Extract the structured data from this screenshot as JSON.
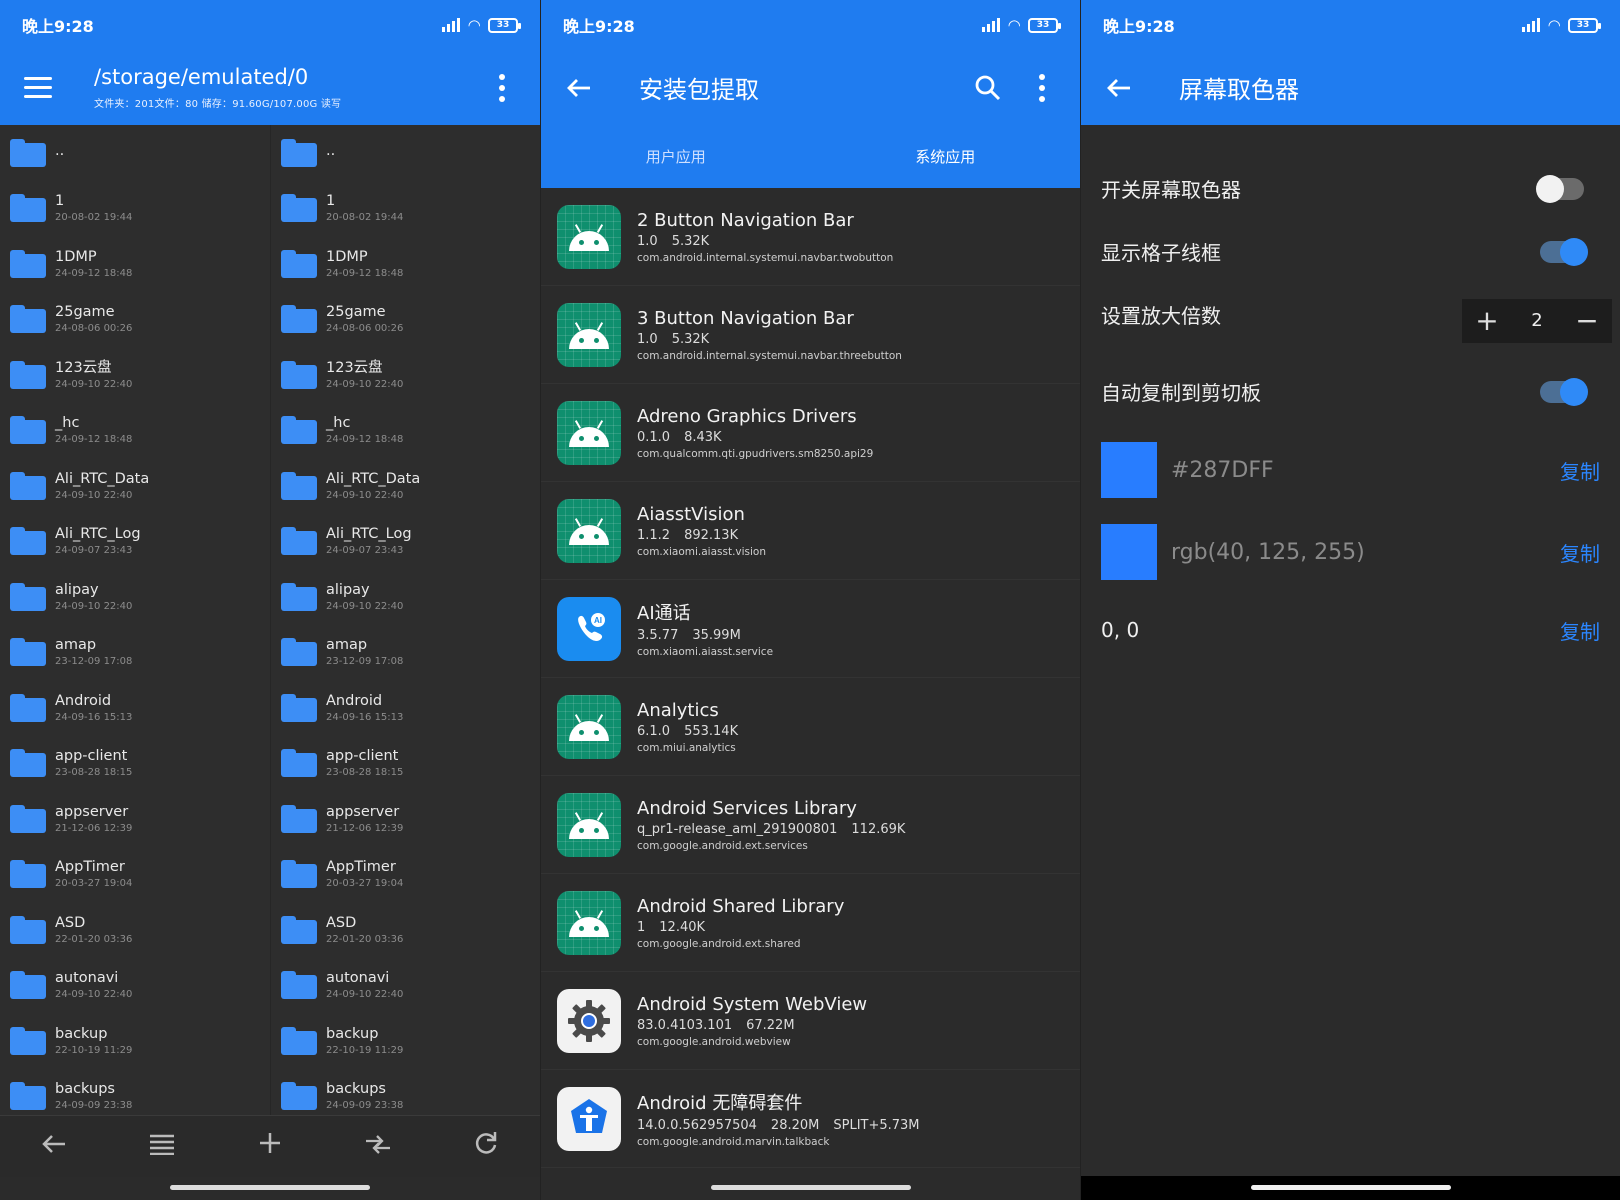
{
  "status": {
    "time": "晚上9:28",
    "battery": "33"
  },
  "screen1": {
    "path": "/storage/emulated/0",
    "subtitle": "文件夹：201文件：80   储存：91.60G/107.00G        读写",
    "folders": [
      {
        "name": "..",
        "date": ""
      },
      {
        "name": "1",
        "date": "20-08-02 19:44"
      },
      {
        "name": "1DMP",
        "date": "24-09-12 18:48"
      },
      {
        "name": "25game",
        "date": "24-08-06 00:26"
      },
      {
        "name": "123云盘",
        "date": "24-09-10 22:40"
      },
      {
        "name": "_hc",
        "date": "24-09-12 18:48"
      },
      {
        "name": "Ali_RTC_Data",
        "date": "24-09-10 22:40"
      },
      {
        "name": "Ali_RTC_Log",
        "date": "24-09-07 23:43"
      },
      {
        "name": "alipay",
        "date": "24-09-10 22:40"
      },
      {
        "name": "amap",
        "date": "23-12-09 17:08"
      },
      {
        "name": "Android",
        "date": "24-09-16 15:13"
      },
      {
        "name": "app-client",
        "date": "23-08-28 18:15"
      },
      {
        "name": "appserver",
        "date": "21-12-06 12:39"
      },
      {
        "name": "AppTimer",
        "date": "20-03-27 19:04"
      },
      {
        "name": "ASD",
        "date": "22-01-20 03:36"
      },
      {
        "name": "autonavi",
        "date": "24-09-10 22:40"
      },
      {
        "name": "backup",
        "date": "22-10-19 11:29"
      },
      {
        "name": "backups",
        "date": "24-09-09 23:38"
      }
    ],
    "bottom_icons": [
      "back-arrow-icon",
      "list-icon",
      "add-icon",
      "swap-icon",
      "refresh-icon"
    ]
  },
  "screen2": {
    "title": "安装包提取",
    "tabs": [
      "用户应用",
      "系统应用"
    ],
    "active_tab": 1,
    "apps": [
      {
        "name": "2 Button Navigation Bar",
        "version": "1.0",
        "size": "5.32K",
        "extra": "",
        "package": "com.android.internal.systemui.navbar.twobutton",
        "icon": "android"
      },
      {
        "name": "3 Button Navigation Bar",
        "version": "1.0",
        "size": "5.32K",
        "extra": "",
        "package": "com.android.internal.systemui.navbar.threebutton",
        "icon": "android"
      },
      {
        "name": "Adreno Graphics Drivers",
        "version": "0.1.0",
        "size": "8.43K",
        "extra": "",
        "package": "com.qualcomm.qti.gpudrivers.sm8250.api29",
        "icon": "android"
      },
      {
        "name": "AiasstVision",
        "version": "1.1.2",
        "size": "892.13K",
        "extra": "",
        "package": "com.xiaomi.aiasst.vision",
        "icon": "android"
      },
      {
        "name": "AI通话",
        "version": "3.5.77",
        "size": "35.99M",
        "extra": "",
        "package": "com.xiaomi.aiasst.service",
        "icon": "call"
      },
      {
        "name": "Analytics",
        "version": "6.1.0",
        "size": "553.14K",
        "extra": "",
        "package": "com.miui.analytics",
        "icon": "android"
      },
      {
        "name": "Android Services Library",
        "version": "q_pr1-release_aml_291900801",
        "size": "112.69K",
        "extra": "",
        "package": "com.google.android.ext.services",
        "icon": "android"
      },
      {
        "name": "Android Shared Library",
        "version": "1",
        "size": "12.40K",
        "extra": "",
        "package": "com.google.android.ext.shared",
        "icon": "android"
      },
      {
        "name": "Android System WebView",
        "version": "83.0.4103.101",
        "size": "67.22M",
        "extra": "",
        "package": "com.google.android.webview",
        "icon": "webview"
      },
      {
        "name": "Android 无障碍套件",
        "version": "14.0.0.562957504",
        "size": "28.20M",
        "extra": "SPLIT+5.73M",
        "package": "com.google.android.marvin.talkback",
        "icon": "accessibility"
      }
    ]
  },
  "screen3": {
    "title": "屏幕取色器",
    "toggle_picker_label": "开关屏幕取色器",
    "toggle_picker_on": false,
    "grid_label": "显示格子线框",
    "grid_on": true,
    "zoom_label": "设置放大倍数",
    "zoom_value": "2",
    "autocopy_label": "自动复制到剪切板",
    "autocopy_on": true,
    "hex_value": "#287DFF",
    "rgb_value": "rgb(40, 125, 255)",
    "coords": "0, 0",
    "copy_label": "复制",
    "swatch_color": "#287DFF"
  },
  "colors": {
    "accent": "#1F7CF0",
    "background": "#2B2B2B",
    "link": "#2B86FF"
  }
}
